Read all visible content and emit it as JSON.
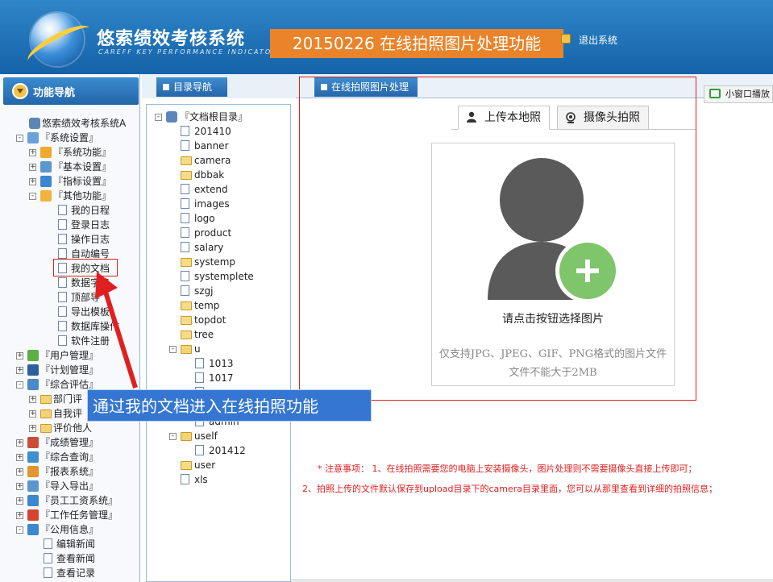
{
  "header": {
    "app_title": "悠索绩效考核系统",
    "app_subtitle": "CAREFF KEY PERFORMANCE INDICATOR",
    "banner_caption": "20150226 在线拍照图片处理功能",
    "logout": "退出系统"
  },
  "nav": {
    "title": "功能导航",
    "items": [
      {
        "label": "悠索绩效考核系统A",
        "level": 0,
        "type": "root"
      },
      {
        "label": "『系统设置』",
        "level": 1,
        "expander": "-",
        "icon": "settings-icon"
      },
      {
        "label": "『系统功能』",
        "level": 2,
        "expander": "+",
        "icon": "home-icon"
      },
      {
        "label": "『基本设置』",
        "level": 2,
        "expander": "+",
        "icon": "grid-icon"
      },
      {
        "label": "『指标设置』",
        "level": 2,
        "expander": "+",
        "icon": "monitor-icon"
      },
      {
        "label": "『其他功能』",
        "level": 2,
        "expander": "-",
        "icon": "disc-icon"
      },
      {
        "label": "我的日程",
        "level": 3,
        "icon": "doc"
      },
      {
        "label": "登录日志",
        "level": 3,
        "icon": "doc"
      },
      {
        "label": "操作日志",
        "level": 3,
        "icon": "doc"
      },
      {
        "label": "自动编号",
        "level": 3,
        "icon": "doc"
      },
      {
        "label": "我的文档",
        "level": 3,
        "icon": "doc"
      },
      {
        "label": "数据字典",
        "level": 3,
        "icon": "doc"
      },
      {
        "label": "顶部导",
        "level": 3,
        "icon": "doc"
      },
      {
        "label": "导出模板",
        "level": 3,
        "icon": "doc"
      },
      {
        "label": "数据库操作",
        "level": 3,
        "icon": "doc"
      },
      {
        "label": "软件注册",
        "level": 3,
        "icon": "doc"
      },
      {
        "label": "『用户管理』",
        "level": 1,
        "expander": "+",
        "icon": "user-icon"
      },
      {
        "label": "『计划管理』",
        "level": 1,
        "expander": "+",
        "icon": "car-icon"
      },
      {
        "label": "『综合评估』",
        "level": 1,
        "expander": "-",
        "icon": "chart-icon"
      },
      {
        "label": "部门评",
        "level": 2,
        "expander": "+",
        "icon": "folder"
      },
      {
        "label": "自我评",
        "level": 2,
        "expander": "+",
        "icon": "folder"
      },
      {
        "label": "评价他人",
        "level": 2,
        "expander": "+",
        "icon": "folder"
      },
      {
        "label": "『成绩管理』",
        "level": 1,
        "expander": "+",
        "icon": "calendar-icon"
      },
      {
        "label": "『综合查询』",
        "level": 1,
        "expander": "+",
        "icon": "search-icon"
      },
      {
        "label": "『报表系统』",
        "level": 1,
        "expander": "+",
        "icon": "pie-icon"
      },
      {
        "label": "『导入导出』",
        "level": 1,
        "expander": "+",
        "icon": "grid-icon"
      },
      {
        "label": "『员工工资系统』",
        "level": 1,
        "expander": "+",
        "icon": "monitor-icon"
      },
      {
        "label": "『工作任务管理』",
        "level": 1,
        "expander": "+",
        "icon": "flag-icon"
      },
      {
        "label": "『公用信息』",
        "level": 1,
        "expander": "-",
        "icon": "monitor-icon"
      },
      {
        "label": "编辑新闻",
        "level": 2,
        "icon": "doc"
      },
      {
        "label": "查看新闻",
        "level": 2,
        "icon": "doc"
      },
      {
        "label": "查看记录",
        "level": 2,
        "icon": "doc"
      }
    ]
  },
  "middle": {
    "tab_label": "目录导航",
    "tree": [
      {
        "label": "『文档根目录』",
        "level": 0,
        "expander": "-",
        "icon": "root"
      },
      {
        "label": "201410",
        "level": 1,
        "icon": "doc"
      },
      {
        "label": "banner",
        "level": 1,
        "icon": "doc"
      },
      {
        "label": "camera",
        "level": 1,
        "icon": "folder-open"
      },
      {
        "label": "dbbak",
        "level": 1,
        "icon": "folder-open"
      },
      {
        "label": "extend",
        "level": 1,
        "icon": "doc"
      },
      {
        "label": "images",
        "level": 1,
        "icon": "doc"
      },
      {
        "label": "logo",
        "level": 1,
        "icon": "doc"
      },
      {
        "label": "product",
        "level": 1,
        "icon": "doc"
      },
      {
        "label": "salary",
        "level": 1,
        "icon": "doc"
      },
      {
        "label": "systemp",
        "level": 1,
        "icon": "folder-open"
      },
      {
        "label": "systemplete",
        "level": 1,
        "icon": "doc"
      },
      {
        "label": "szgj",
        "level": 1,
        "icon": "doc"
      },
      {
        "label": "temp",
        "level": 1,
        "icon": "folder-open"
      },
      {
        "label": "topdot",
        "level": 1,
        "icon": "folder-open"
      },
      {
        "label": "tree",
        "level": 1,
        "icon": "folder-open"
      },
      {
        "label": "u",
        "level": 1,
        "expander": "-",
        "icon": "folder"
      },
      {
        "label": "1013",
        "level": 2,
        "icon": "doc"
      },
      {
        "label": "1017",
        "level": 2,
        "icon": "doc"
      },
      {
        "label": "",
        "level": 2,
        "icon": "doc"
      },
      {
        "label": "",
        "level": 2,
        "icon": "doc"
      },
      {
        "label": "admin",
        "level": 2,
        "icon": "doc"
      },
      {
        "label": "uself",
        "level": 1,
        "expander": "-",
        "icon": "folder"
      },
      {
        "label": "201412",
        "level": 2,
        "icon": "doc"
      },
      {
        "label": "user",
        "level": 1,
        "icon": "folder-open"
      },
      {
        "label": "xls",
        "level": 1,
        "icon": "doc"
      }
    ]
  },
  "right": {
    "tab_label": "在线拍照图片处理",
    "small_window": "小窗口播放",
    "upload_tab": "上传本地照",
    "camera_tab": "摄像头拍照",
    "upload_prompt": "请点击按钮选择图片",
    "hint_formats": "仅支持JPG、JPEG、GIF、PNG格式的图片文件",
    "hint_size": "文件不能大于2MB",
    "note_1": "* 注意事项： 1、在线拍照需要您的电脑上安装摄像头，图片处理则不需要摄像头直接上传即可；",
    "note_2": "2、拍照上传的文件默认保存到upload目录下的camera目录里面，您可以从那里查看到详细的拍照信息；"
  },
  "annotation": {
    "callout": "通过我的文档进入在线拍照功能"
  },
  "colors": {
    "header_blue": "#1f74bd",
    "banner_orange": "#e9842b",
    "highlight_red": "#d8241f",
    "callout_blue": "#3476d1",
    "add_green": "#7fc56b",
    "avatar_gray": "#5a5a5a"
  }
}
